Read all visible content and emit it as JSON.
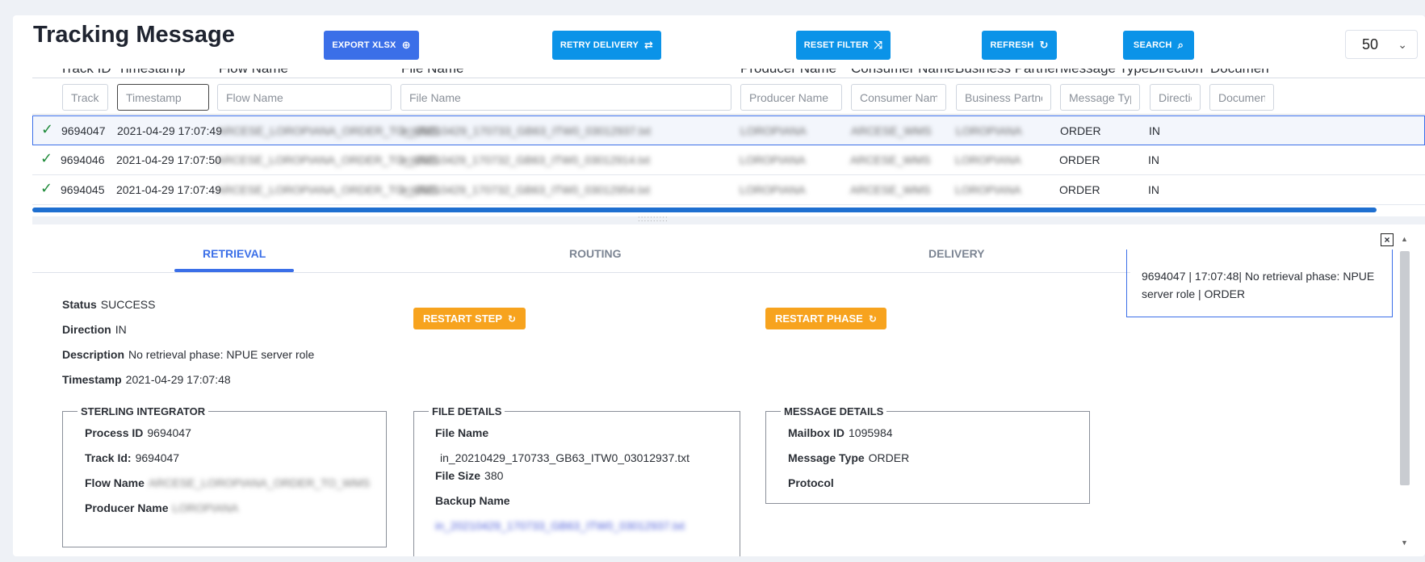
{
  "page_title": "Tracking Message",
  "toolbar": {
    "export_label": "EXPORT XLSX",
    "retry_label": "RETRY DELIVERY",
    "reset_label": "RESET FILTER",
    "refresh_label": "REFRESH",
    "search_label": "SEARCH",
    "page_size": "50",
    "export_icon": "⊕",
    "retry_icon": "⇄",
    "reset_icon": "⤨",
    "refresh_icon": "↻",
    "search_icon": "⌕",
    "chevron_icon": "⌄"
  },
  "grid": {
    "columns": [
      "Track ID",
      "Timestamp",
      "Flow Name",
      "File Name",
      "Producer Name",
      "Consumer Name",
      "Business Partner",
      "Message Type",
      "Direction",
      "Documen"
    ],
    "filter_placeholders": [
      "Track I",
      "Timestamp",
      "Flow Name",
      "File Name",
      "Producer Name",
      "Consumer Name",
      "Business Partner",
      "Message Type",
      "Directio",
      "Documen"
    ],
    "rows": [
      {
        "status_icon": "✓",
        "track_id": "9694047",
        "timestamp": "2021-04-29 17:07:49",
        "flow_name": "ARCESE_LOROPIANA_ORDER_TO_WMS",
        "file_name": "in_20210429_170733_GB63_ITW0_03012937.txt",
        "producer": "LOROPIANA",
        "consumer": "ARCESE_WMS",
        "partner": "LOROPIANA",
        "message_type": "ORDER",
        "direction": "IN"
      },
      {
        "status_icon": "✓",
        "track_id": "9694046",
        "timestamp": "2021-04-29 17:07:50",
        "flow_name": "ARCESE_LOROPIANA_ORDER_TO_WMS",
        "file_name": "in_20210429_170732_GB63_ITW0_03012914.txt",
        "producer": "LOROPIANA",
        "consumer": "ARCESE_WMS",
        "partner": "LOROPIANA",
        "message_type": "ORDER",
        "direction": "IN"
      },
      {
        "status_icon": "✓",
        "track_id": "9694045",
        "timestamp": "2021-04-29 17:07:49",
        "flow_name": "ARCESE_LOROPIANA_ORDER_TO_WMS",
        "file_name": "in_20210429_170732_GB63_ITW0_03012954.txt",
        "producer": "LOROPIANA",
        "consumer": "ARCESE_WMS",
        "partner": "LOROPIANA",
        "message_type": "ORDER",
        "direction": "IN"
      }
    ]
  },
  "tabs": [
    "RETRIEVAL",
    "ROUTING",
    "DELIVERY"
  ],
  "detail": {
    "status_label": "Status",
    "status": "SUCCESS",
    "direction_label": "Direction",
    "direction": "IN",
    "description_label": "Description",
    "description": "No retrieval phase: NPUE server role",
    "timestamp_label": "Timestamp",
    "timestamp": "2021-04-29 17:07:48",
    "restart_step": "RESTART STEP",
    "restart_phase": "RESTART PHASE",
    "restart_icon": "↻"
  },
  "sterling": {
    "legend": "STERLING INTEGRATOR",
    "process_id_label": "Process ID",
    "process_id": "9694047",
    "track_id_label": "Track Id:",
    "track_id": "9694047",
    "flow_name_label": "Flow Name",
    "flow_name": "ARCESE_LOROPIANA_ORDER_TO_WMS",
    "producer_label": "Producer Name",
    "producer": "LOROPIANA"
  },
  "file_details": {
    "legend": "FILE DETAILS",
    "file_name_label": "File Name",
    "file_name": "in_20210429_170733_GB63_ITW0_03012937.txt",
    "file_size_label": "File Size",
    "file_size": "380",
    "backup_name_label": "Backup Name",
    "backup_name": "in_20210429_170733_GB63_ITW0_03012937.txt"
  },
  "message_details": {
    "legend": "MESSAGE DETAILS",
    "mailbox_label": "Mailbox ID",
    "mailbox_id": "1095984",
    "message_type_label": "Message Type",
    "message_type": "ORDER",
    "protocol_label": "Protocol",
    "protocol": ""
  },
  "log": {
    "text": "9694047 | 17:07:48| No retrieval phase: NPUE server role | ORDER",
    "close_icon": "×"
  },
  "splitter_grip": "::::::::::",
  "colors": {
    "primary": "#3b6fe8",
    "accent": "#0b93e8",
    "orange": "#f7a31e",
    "success": "#1f8b3a"
  }
}
